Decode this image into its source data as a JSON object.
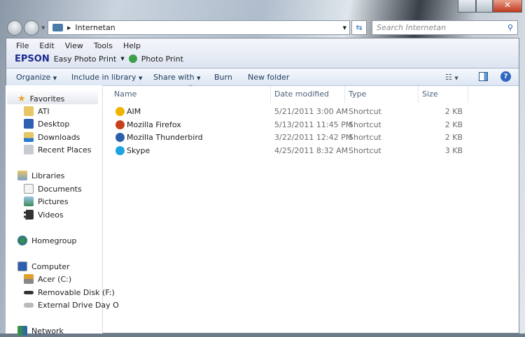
{
  "window": {
    "controls": {
      "minimize": "minimize",
      "maximize": "maximize",
      "close": "close"
    }
  },
  "address": {
    "path": "Internetan",
    "search_placeholder": "Search Internetan"
  },
  "menu": [
    "File",
    "Edit",
    "View",
    "Tools",
    "Help"
  ],
  "epson": {
    "brand": "EPSON",
    "easy_photo_print": "Easy Photo Print",
    "photo_print": "Photo Print"
  },
  "toolbar": {
    "organize": "Organize",
    "include": "Include in library",
    "share": "Share with",
    "burn": "Burn",
    "new_folder": "New folder"
  },
  "sidebar": {
    "favorites": "Favorites",
    "fav_items": [
      "ATI",
      "Desktop",
      "Downloads",
      "Recent Places"
    ],
    "libraries": "Libraries",
    "lib_items": [
      "Documents",
      "Pictures",
      "Videos"
    ],
    "homegroup": "Homegroup",
    "computer": "Computer",
    "comp_items": [
      "Acer (C:)",
      "Removable Disk (F:)",
      "External Drive Day O"
    ],
    "network": "Network"
  },
  "columns": {
    "name": "Name",
    "date": "Date modified",
    "type": "Type",
    "size": "Size"
  },
  "files": [
    {
      "name": "AIM",
      "date": "5/21/2011 3:00 AM",
      "type": "Shortcut",
      "size": "2 KB",
      "icon": "aim-icon",
      "color": "#f0b400"
    },
    {
      "name": "Mozilla Firefox",
      "date": "5/13/2011 11:45 PM",
      "type": "Shortcut",
      "size": "2 KB",
      "icon": "firefox-icon",
      "color": "#c8401a"
    },
    {
      "name": "Mozilla Thunderbird",
      "date": "3/22/2011 12:42 PM",
      "type": "Shortcut",
      "size": "2 KB",
      "icon": "thunderbird-icon",
      "color": "#2c5fa8"
    },
    {
      "name": "Skype",
      "date": "4/25/2011 8:32 AM",
      "type": "Shortcut",
      "size": "3 KB",
      "icon": "skype-icon",
      "color": "#1ea4e0"
    }
  ]
}
